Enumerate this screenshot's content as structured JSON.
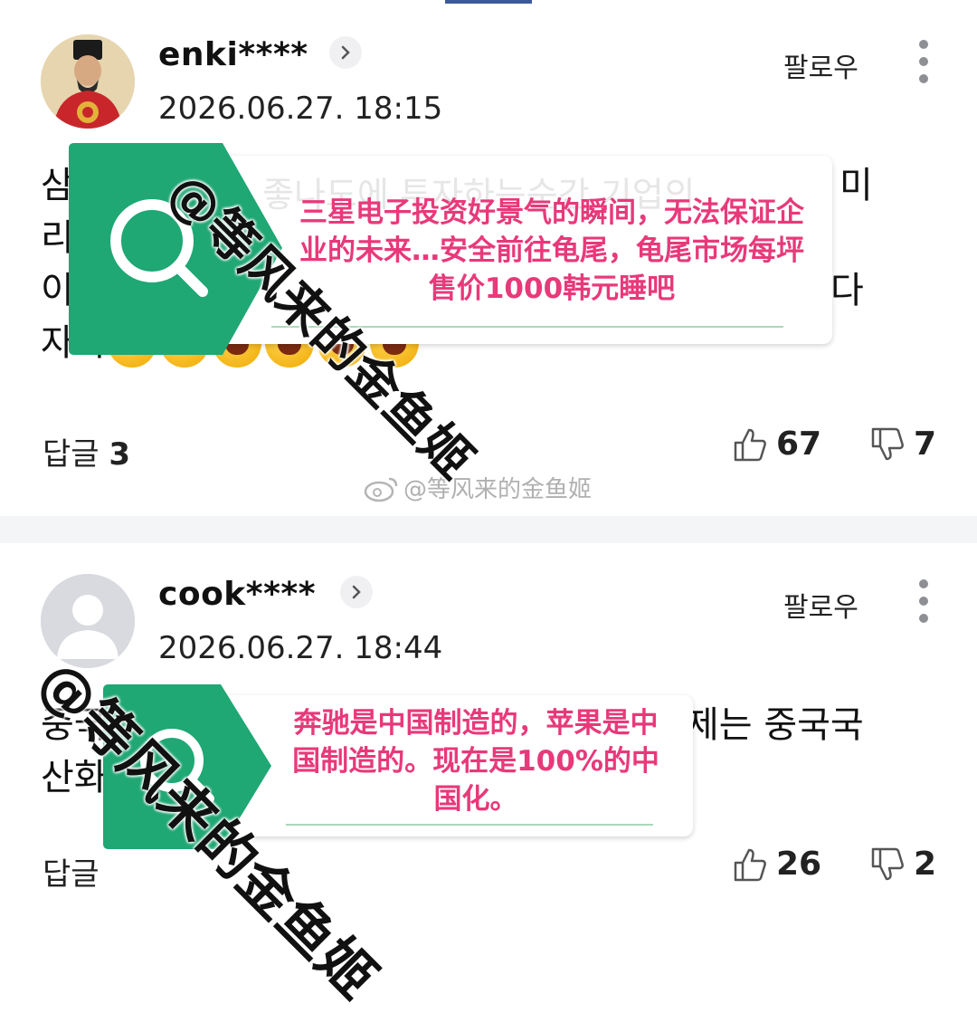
{
  "comments": [
    {
      "username": "enki****",
      "timestamp": "2026.06.27. 18:15",
      "follow_label": "팔로우",
      "body_lines": [
        "삼",
        "리",
        "이",
        "자나"
      ],
      "body_hidden_fragments": [
        "좋나도에 투자하는순간 기업의",
        "미",
        "다"
      ],
      "emoji_count": 6,
      "reply_label": "답글",
      "reply_count": "3",
      "likes": "67",
      "dislikes": "7",
      "translation": "三星电子投资好景气的瞬间，无法保证企业的未来…安全前往龟尾，龟尾市场每坪售价1000韩元睡吧"
    },
    {
      "username": "cook****",
      "timestamp": "2026.06.27. 18:44",
      "follow_label": "팔로우",
      "body_lines": [
        "중국",
        "산화"
      ],
      "body_visible_right": "제는 중국국",
      "reply_label": "답글",
      "reply_count": "",
      "likes": "26",
      "dislikes": "2",
      "translation": "奔驰是中国制造的，苹果是中国制造的。现在是100%的中国化。"
    }
  ],
  "watermark": {
    "text": "@等风来的金鱼姬",
    "weibo_text": "@等风来的金鱼姬"
  },
  "colors": {
    "accent_green": "#1fa774",
    "translation_pink": "#e8397a",
    "kebab_gray": "#8e8f94",
    "divider_gray": "#f4f5f7"
  },
  "icons": [
    "chevron-right-icon",
    "kebab-menu-icon",
    "thumbs-up-icon",
    "thumbs-down-icon",
    "magnifier-icon",
    "weibo-icon"
  ]
}
